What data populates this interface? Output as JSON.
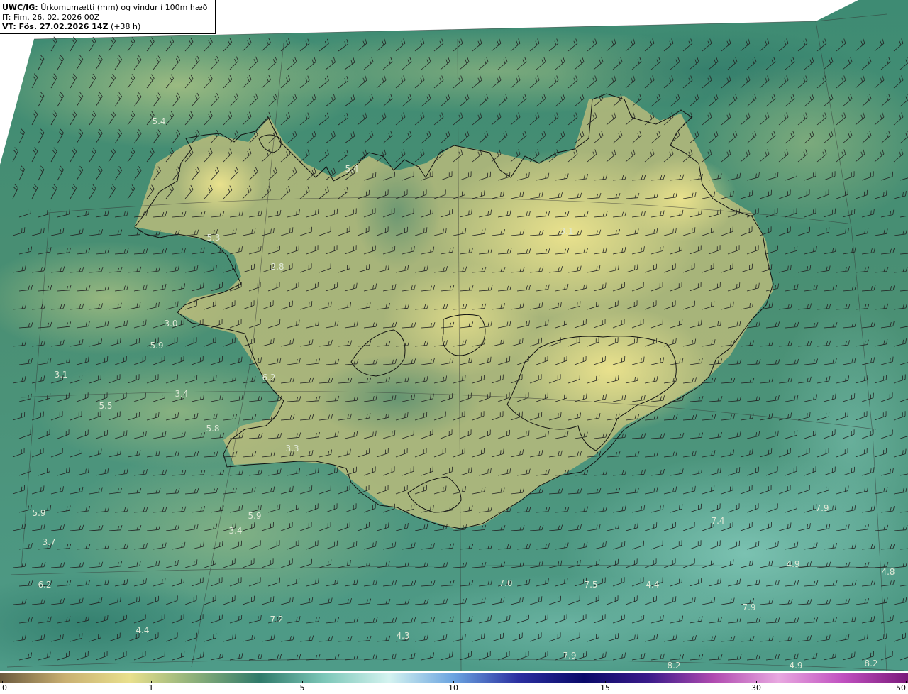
{
  "header": {
    "model": "UWC/IG:",
    "product": "Úrkomumætti (mm) og vindur í 100m hæð",
    "initial_time": "IT: Fim. 26. 02. 2026 00Z",
    "valid_prefix": "VT: Fös. 27.02.2026 14Z",
    "lead_time": "(+38 h)"
  },
  "colorbar": {
    "ticks": [
      "0",
      "1",
      "5",
      "10",
      "15",
      "30",
      "50"
    ],
    "stops": [
      "#6b5a3e",
      "#c9b071",
      "#e9e08c",
      "#8cb07a",
      "#2f7a6a",
      "#7cc7b8",
      "#d4f3f0",
      "#6aa3e0",
      "#2a2ea0",
      "#0a0a6a",
      "#3a1a8a",
      "#b04ab0",
      "#e8a8e0",
      "#c050c0",
      "#7a1a7a"
    ]
  },
  "map": {
    "background_colors": {
      "ocean_north": "#3d8a72",
      "ocean_south": "#4c9a86",
      "land_dry": "#e0d98a",
      "land_mid": "#a9b773",
      "coastline": "#111111",
      "barb": "#222222"
    },
    "value_labels": [
      "5.4",
      "5.4",
      "5.3",
      "2.8",
      "3.1",
      "3.0",
      "5.9",
      "3.1",
      "6.2",
      "3.4",
      "5.5",
      "5.8",
      "3.3",
      "5.9",
      "5.9",
      "3.4",
      "3.7",
      "6.2",
      "4.4",
      "7.2",
      "4.3",
      "7.0",
      "7.5",
      "4.4",
      "7.4",
      "7.9",
      "4.9",
      "4.8",
      "7.9",
      "7.9",
      "8.2",
      "4.9",
      "8.2"
    ]
  }
}
